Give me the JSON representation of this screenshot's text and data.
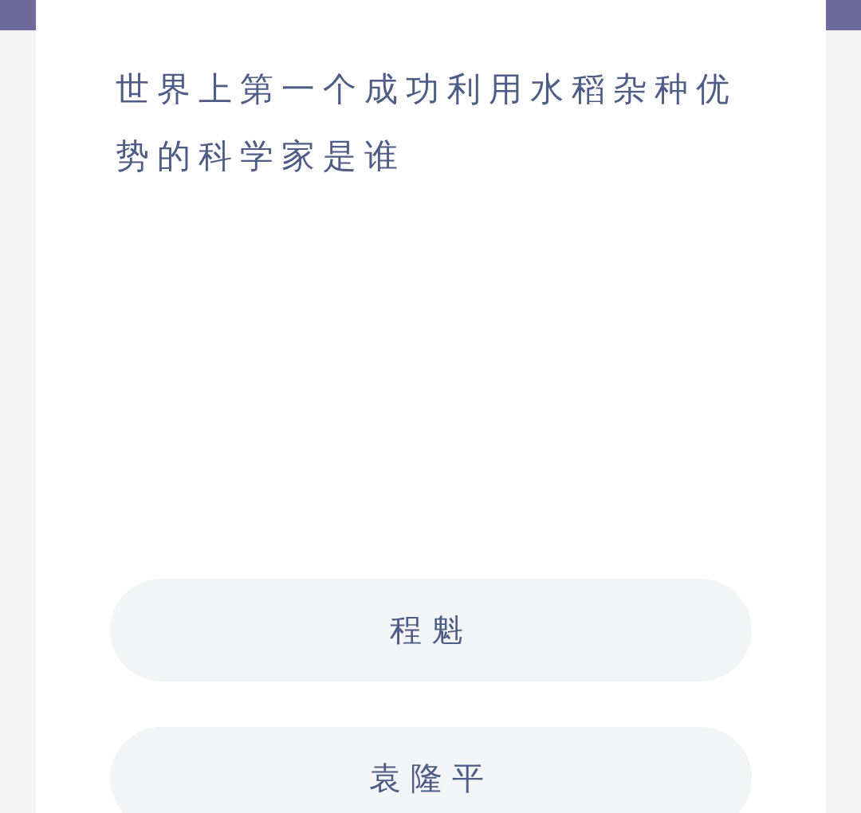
{
  "question": "世界上第一个成功利用水稻杂种优势的科学家是谁",
  "options": [
    {
      "text": "程魁"
    },
    {
      "text": "袁隆平"
    }
  ]
}
